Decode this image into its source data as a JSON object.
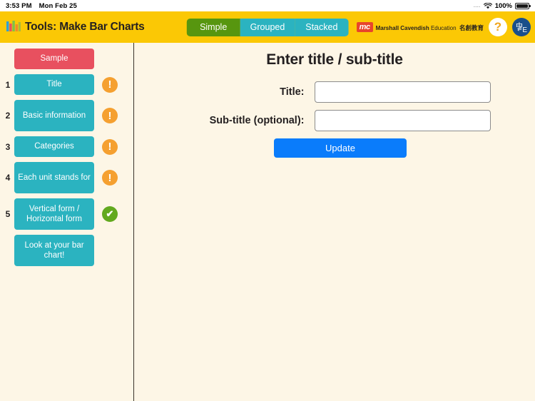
{
  "statusbar": {
    "time": "3:53 PM",
    "date": "Mon Feb 25",
    "dots": "....",
    "wifi_icon": "wifi-icon",
    "battery_percent": "100%",
    "battery_icon": "battery-full-icon"
  },
  "header": {
    "app_icon": "bar-chart-icon",
    "title": "Tools: Make Bar Charts",
    "tabs": [
      {
        "label": "Simple",
        "active": true
      },
      {
        "label": "Grouped",
        "active": false
      },
      {
        "label": "Stacked",
        "active": false
      }
    ],
    "logo": {
      "mark": "mc",
      "line1_bold": "Marshall Cavendish ",
      "line1_light": "Education",
      "line2": "名創教育"
    },
    "help_label": "?",
    "language": {
      "cn": "中",
      "en": "E",
      "arrows": "⇄"
    },
    "colors": {
      "header_bg": "#fbc805",
      "tab_active": "#57960f",
      "tab_inactive": "#2bb3c0",
      "logo_mark_bg": "#e8442c"
    }
  },
  "sidebar": {
    "items": [
      {
        "num": "",
        "label": "Sample",
        "status": "none",
        "kind": "sample"
      },
      {
        "num": "1",
        "label": "Title",
        "status": "warn",
        "kind": "step"
      },
      {
        "num": "2",
        "label": "Basic information",
        "status": "warn",
        "kind": "step"
      },
      {
        "num": "3",
        "label": "Categories",
        "status": "warn",
        "kind": "step"
      },
      {
        "num": "4",
        "label": "Each unit stands for",
        "status": "warn",
        "kind": "step"
      },
      {
        "num": "5",
        "label": "Vertical form / Horizontal form",
        "status": "ok",
        "kind": "step"
      },
      {
        "num": "",
        "label": "Look at your bar chart!",
        "status": "none",
        "kind": "step"
      }
    ],
    "status_glyphs": {
      "warn": "!",
      "ok": "✔"
    },
    "colors": {
      "sample_bg": "#e8505f",
      "step_bg": "#2bb3c0",
      "warn": "#f5a030",
      "ok": "#62a91e"
    }
  },
  "main": {
    "title": "Enter title / sub-title",
    "fields": [
      {
        "label": "Title:",
        "value": "",
        "placeholder": ""
      },
      {
        "label": "Sub-title (optional):",
        "value": "",
        "placeholder": ""
      }
    ],
    "update_label": "Update",
    "colors": {
      "update_bg": "#0a7cfb",
      "page_bg": "#fdf6e6"
    }
  }
}
